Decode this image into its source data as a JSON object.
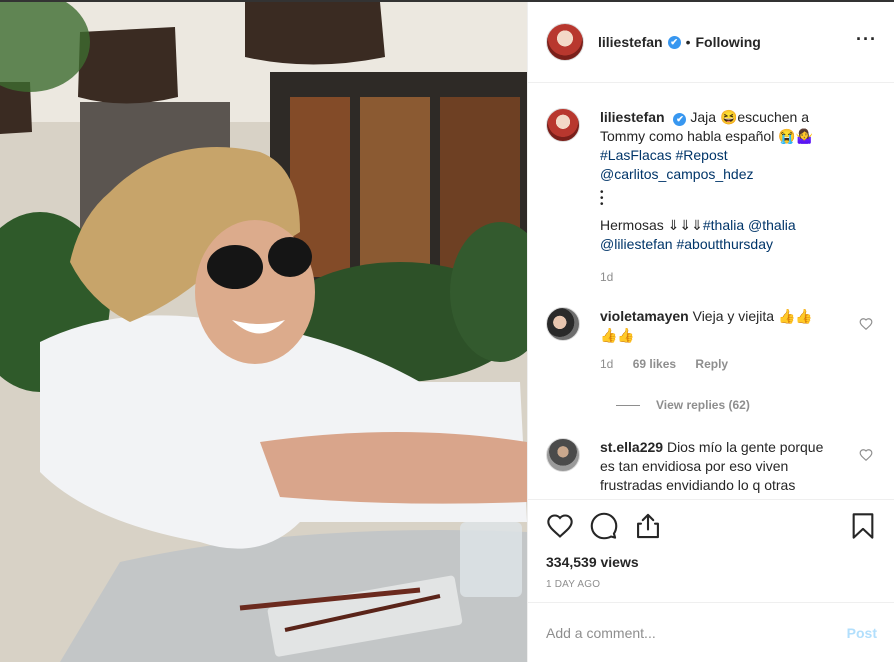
{
  "post": {
    "author": "liliestefan",
    "verified_mark": "✔",
    "separator": "•",
    "follow_status": "Following",
    "more_label": "···"
  },
  "caption": {
    "username": "liliestefan",
    "text1": "Jaja 😆escuchen a Tommy como habla español 😭🤷‍♀️",
    "tags1": "#LasFlacas #Repost",
    "mention1": "@carlitos_campos_hdez",
    "dots": "•\n•\n•",
    "line2": "Hermosas ⇓⇓⇓",
    "tags2": "#thalia @thalia @liliestefan #aboutthursday",
    "time": "1d"
  },
  "comments": [
    {
      "username": "violetamayen",
      "text": "Vieja y viejita 👍👍👍👍",
      "time": "1d",
      "likes": "69 likes",
      "reply": "Reply",
      "view_replies": "View replies (62)"
    },
    {
      "username": "st.ella229",
      "text": "Dios mío la gente porque es tan envidiosa por eso viven frustradas envidiando lo q otras tienen ellas felices me"
    }
  ],
  "stats": {
    "views": "334,539 views",
    "date": "1 DAY AGO"
  },
  "add_comment": {
    "placeholder": "Add a comment...",
    "post_label": "Post"
  },
  "icons": {
    "like": "heart-icon",
    "comment": "comment-icon",
    "share": "share-icon",
    "save": "bookmark-icon"
  },
  "colors": {
    "link": "#003569",
    "secondary": "#8e8e8e",
    "verified": "#3897f0",
    "post_disabled": "#b2dffc"
  }
}
